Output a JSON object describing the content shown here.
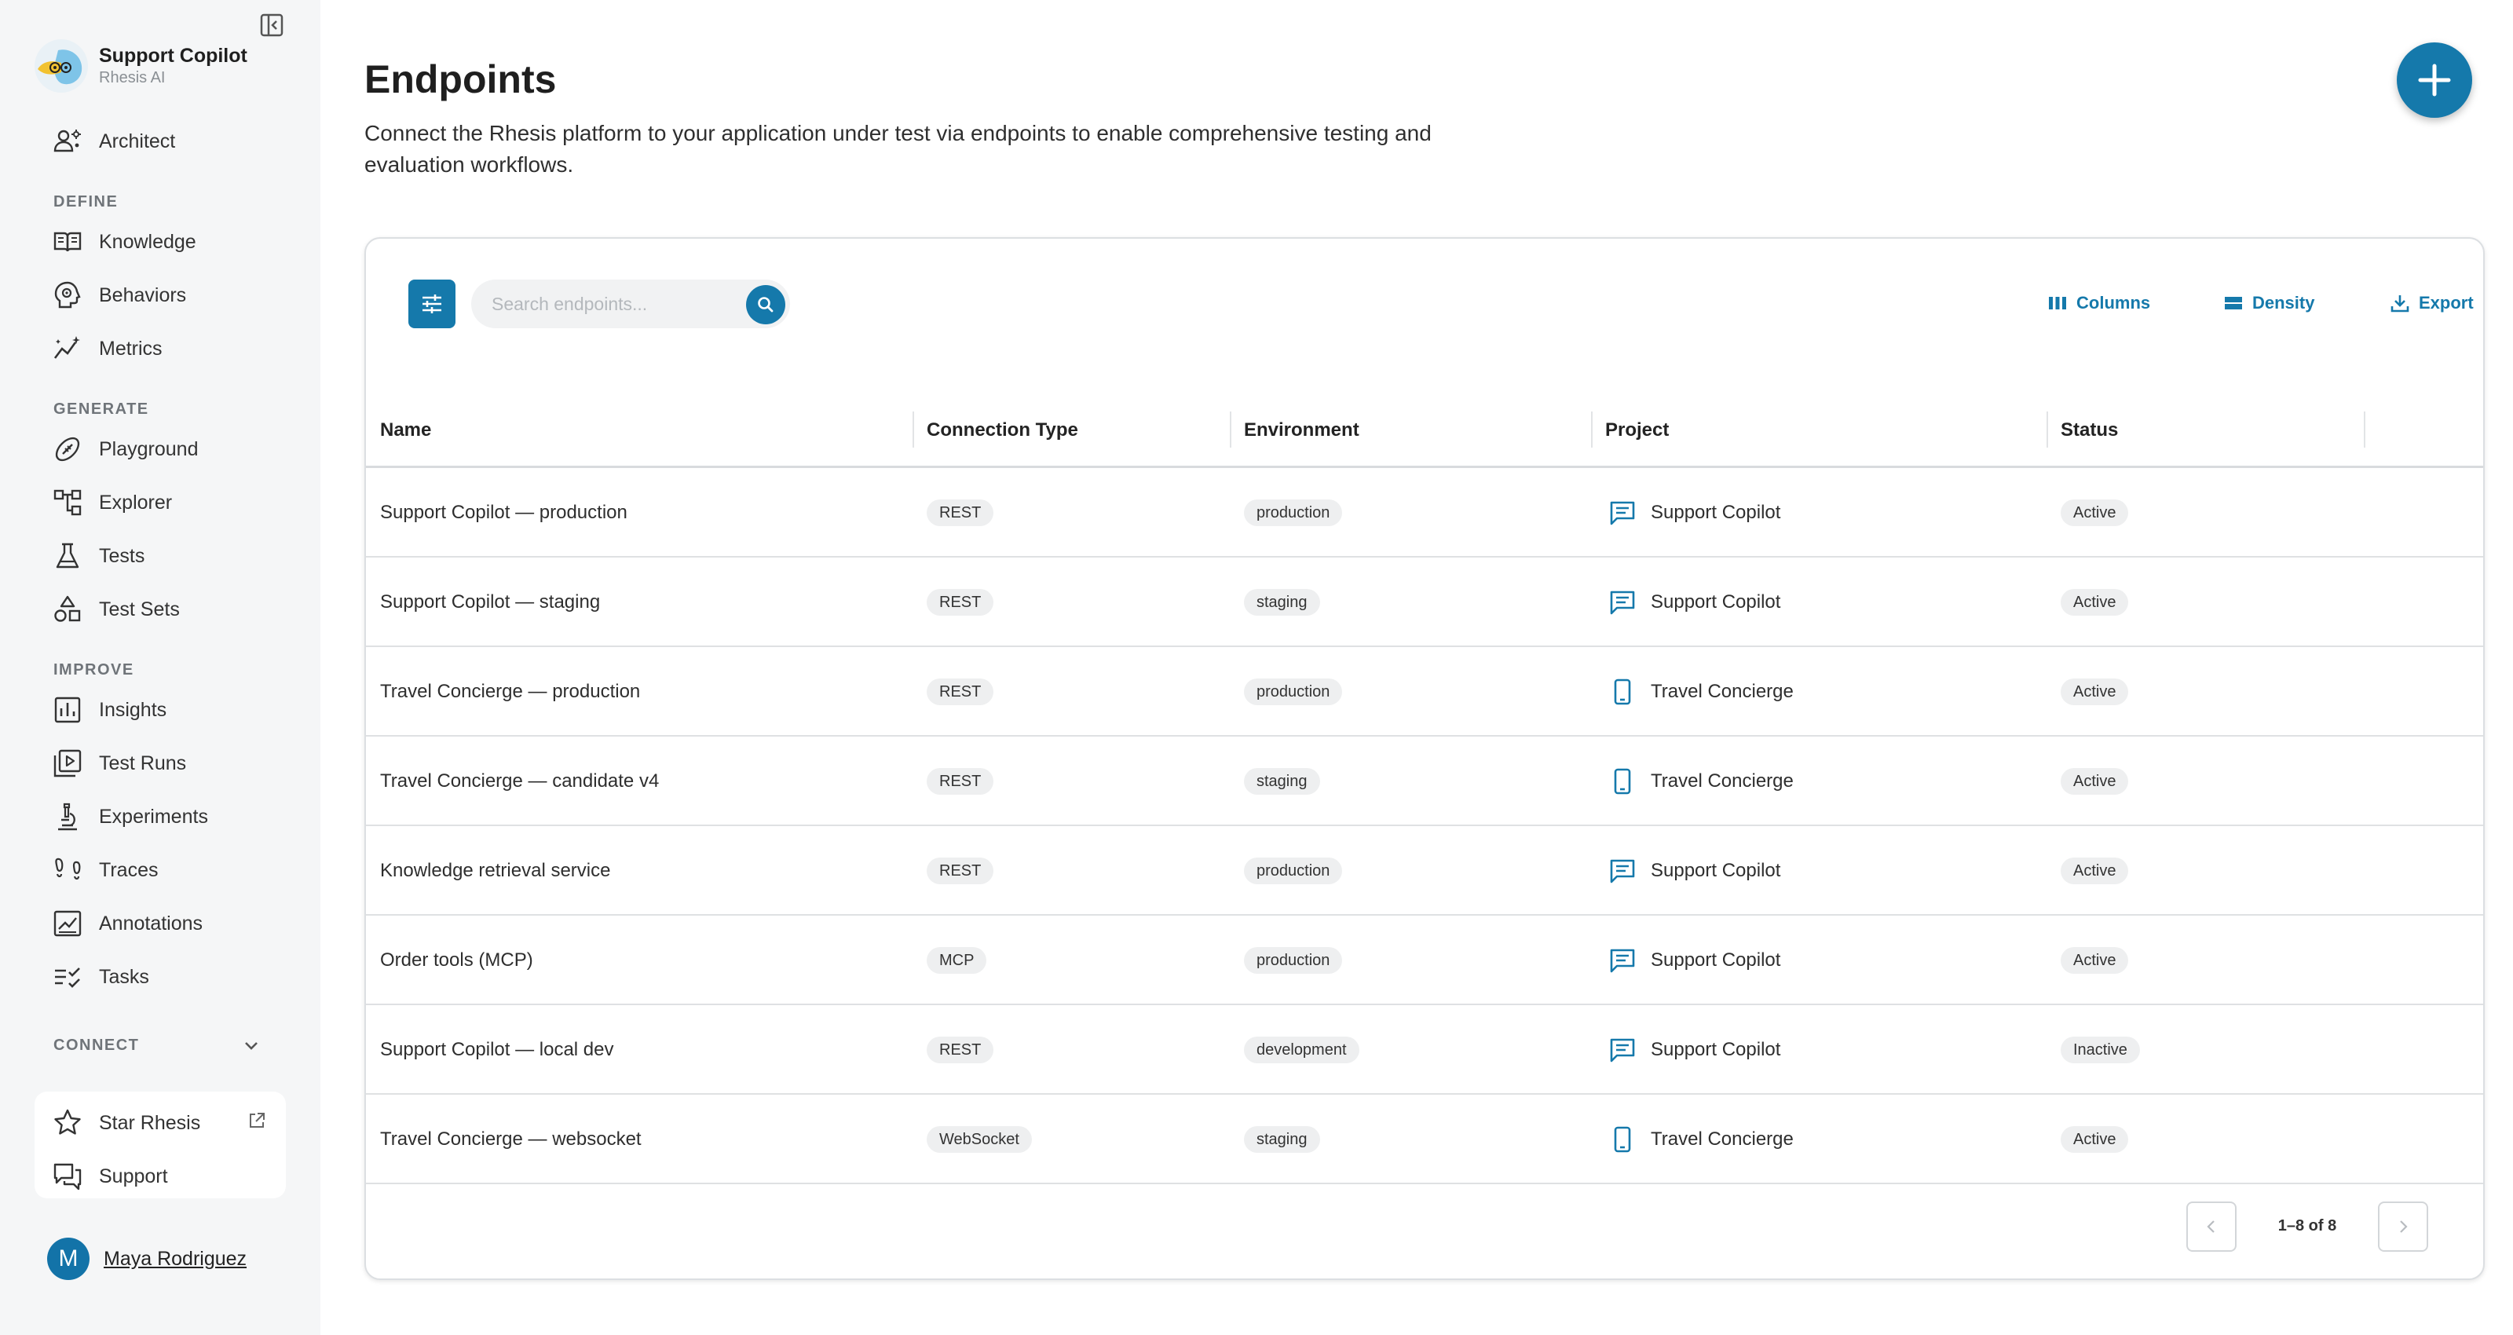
{
  "colors": {
    "accent": "#1579ab",
    "sidebar_bg": "#f5f6f7",
    "chip_bg": "#eeeff0"
  },
  "brand": {
    "title": "Support Copilot",
    "subtitle": "Rhesis AI"
  },
  "sidebar": {
    "top_item": {
      "label": "Architect",
      "icon": "architect-icon"
    },
    "sections": {
      "define": "DEFINE",
      "generate": "GENERATE",
      "improve": "IMPROVE",
      "connect": "CONNECT"
    },
    "define": [
      {
        "label": "Knowledge",
        "icon": "book-icon"
      },
      {
        "label": "Behaviors",
        "icon": "brain-icon"
      },
      {
        "label": "Metrics",
        "icon": "sparkline-icon"
      }
    ],
    "generate": [
      {
        "label": "Playground",
        "icon": "football-icon"
      },
      {
        "label": "Explorer",
        "icon": "hierarchy-icon"
      },
      {
        "label": "Tests",
        "icon": "flask-icon"
      },
      {
        "label": "Test Sets",
        "icon": "shapes-icon"
      }
    ],
    "improve": [
      {
        "label": "Insights",
        "icon": "bar-chart-icon"
      },
      {
        "label": "Test Runs",
        "icon": "play-library-icon"
      },
      {
        "label": "Experiments",
        "icon": "microscope-icon"
      },
      {
        "label": "Traces",
        "icon": "footprints-icon"
      },
      {
        "label": "Annotations",
        "icon": "annotation-icon"
      },
      {
        "label": "Tasks",
        "icon": "checklist-icon"
      }
    ],
    "external": [
      {
        "label": "Star Rhesis",
        "icon": "star-icon"
      },
      {
        "label": "Support",
        "icon": "chat-icon"
      }
    ],
    "user": {
      "initial": "M",
      "name": "Maya Rodriguez"
    }
  },
  "page": {
    "title": "Endpoints",
    "description": "Connect the Rhesis platform to your application under test via endpoints to enable comprehensive testing and evaluation workflows."
  },
  "toolbar": {
    "search_placeholder": "Search endpoints...",
    "columns_label": "Columns",
    "density_label": "Density",
    "export_label": "Export"
  },
  "table": {
    "headers": {
      "name": "Name",
      "connection_type": "Connection Type",
      "environment": "Environment",
      "project": "Project",
      "status": "Status"
    },
    "rows": [
      {
        "name": "Support Copilot — production",
        "connection_type": "REST",
        "environment": "production",
        "project": "Support Copilot",
        "project_icon": "chat-bubble-icon",
        "status": "Active"
      },
      {
        "name": "Support Copilot — staging",
        "connection_type": "REST",
        "environment": "staging",
        "project": "Support Copilot",
        "project_icon": "chat-bubble-icon",
        "status": "Active"
      },
      {
        "name": "Travel Concierge — production",
        "connection_type": "REST",
        "environment": "production",
        "project": "Travel Concierge",
        "project_icon": "phone-icon",
        "status": "Active"
      },
      {
        "name": "Travel Concierge — candidate v4",
        "connection_type": "REST",
        "environment": "staging",
        "project": "Travel Concierge",
        "project_icon": "phone-icon",
        "status": "Active"
      },
      {
        "name": "Knowledge retrieval service",
        "connection_type": "REST",
        "environment": "production",
        "project": "Support Copilot",
        "project_icon": "chat-bubble-icon",
        "status": "Active"
      },
      {
        "name": "Order tools (MCP)",
        "connection_type": "MCP",
        "environment": "production",
        "project": "Support Copilot",
        "project_icon": "chat-bubble-icon",
        "status": "Active"
      },
      {
        "name": "Support Copilot — local dev",
        "connection_type": "REST",
        "environment": "development",
        "project": "Support Copilot",
        "project_icon": "chat-bubble-icon",
        "status": "Inactive"
      },
      {
        "name": "Travel Concierge — websocket",
        "connection_type": "WebSocket",
        "environment": "staging",
        "project": "Travel Concierge",
        "project_icon": "phone-icon",
        "status": "Active"
      }
    ]
  },
  "pagination": {
    "range_text": "1–8 of 8"
  }
}
